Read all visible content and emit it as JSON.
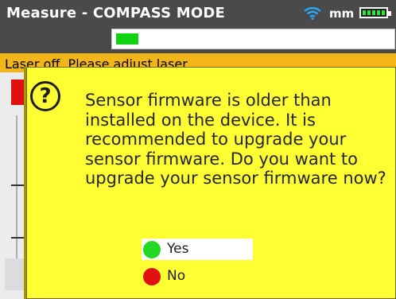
{
  "header": {
    "title": "Measure - COMPASS MODE",
    "unit": "mm",
    "wifi_icon": "wifi-icon",
    "battery_icon": "battery-icon",
    "laser_level_fraction": 0.08
  },
  "status": {
    "message": "Laser off. Please adjust laser"
  },
  "dialog": {
    "icon": "question-icon",
    "message": "Sensor firmware is older than installed on the device. It is recommended to upgrade your sensor firmware. Do you want to upgrade your sensor firmware now?",
    "options": [
      {
        "label": "Yes",
        "color": "#22d822",
        "selected": true
      },
      {
        "label": "No",
        "color": "#e01010",
        "selected": false
      }
    ]
  },
  "colors": {
    "header_bg": "#4a4a4a",
    "status_bg": "#f3b518",
    "dialog_bg": "#ffff33",
    "laser_fill": "#12d012"
  }
}
